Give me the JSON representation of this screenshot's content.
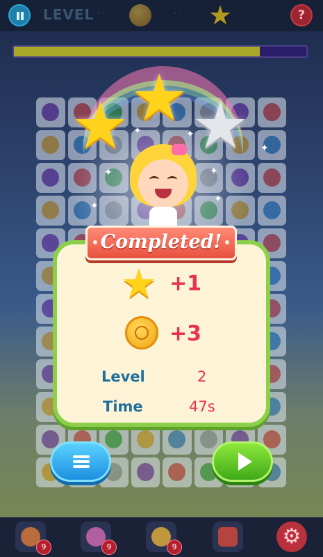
{
  "topbar": {
    "level_word": "LEVEL",
    "help_symbol": "?",
    "dots": "· ·"
  },
  "progress": {
    "fraction": 0.84
  },
  "completed_dialog": {
    "title": "Completed!",
    "stars_earned": 2,
    "stars_total": 3,
    "reward_star": "+1",
    "reward_coins": "+3",
    "level_label": "Level",
    "level_value": "2",
    "time_label": "Time",
    "time_value": "47s"
  },
  "toolbar": {
    "items": [
      {
        "name": "hammer-booster",
        "count": "9"
      },
      {
        "name": "color-bomb-booster",
        "count": "9"
      },
      {
        "name": "swap-booster",
        "count": "9"
      },
      {
        "name": "ad-reward",
        "count": ""
      }
    ]
  },
  "icons": [
    "pause-icon",
    "coin-icon",
    "star-icon",
    "help-icon",
    "menu-icon",
    "play-icon",
    "gear-icon"
  ],
  "colors": {
    "accent_green": "#8ccf4a",
    "accent_red": "#e8334f",
    "label_blue": "#1f6f9c",
    "star_yellow": "#ffd21c"
  }
}
